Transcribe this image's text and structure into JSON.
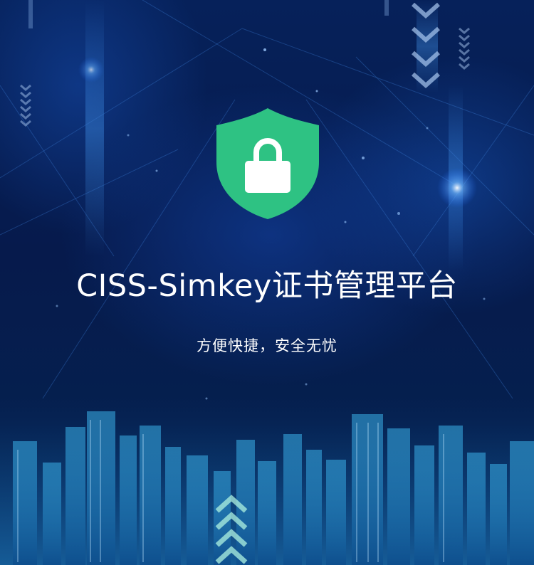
{
  "app": {
    "title": "CISS-Simkey证书管理平台",
    "subtitle": "方便快捷，安全无忧"
  },
  "icons": {
    "hero": "shield-lock-icon"
  },
  "colors": {
    "background": "#061a4a",
    "shield": "#2ec283",
    "lock": "#ffffff",
    "text": "#ffffff"
  }
}
